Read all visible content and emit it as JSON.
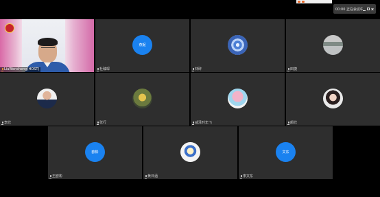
{
  "overlay": {
    "title": "00:00 正在会议中 · 警守右侧右键",
    "orange_strip": ""
  },
  "tiles": [
    {
      "name": "LiuWencheng(HOST)"
    },
    {
      "name": "杜臻琛",
      "avatar_label": "燕妮"
    },
    {
      "name": "林碎"
    },
    {
      "name": "田捷"
    },
    {
      "name": "李欣"
    },
    {
      "name": "张行"
    },
    {
      "name": "咸泽时年飞"
    },
    {
      "name": "颜欣"
    },
    {
      "name": "王欧彬",
      "avatar_label": "欧彬"
    },
    {
      "name": "黄日涵"
    },
    {
      "name": "李文东",
      "avatar_label": "文东"
    }
  ],
  "colors": {
    "tile_bg": "#2e2e2e",
    "avatar_blue": "#1a82f0",
    "background": "#000000"
  }
}
